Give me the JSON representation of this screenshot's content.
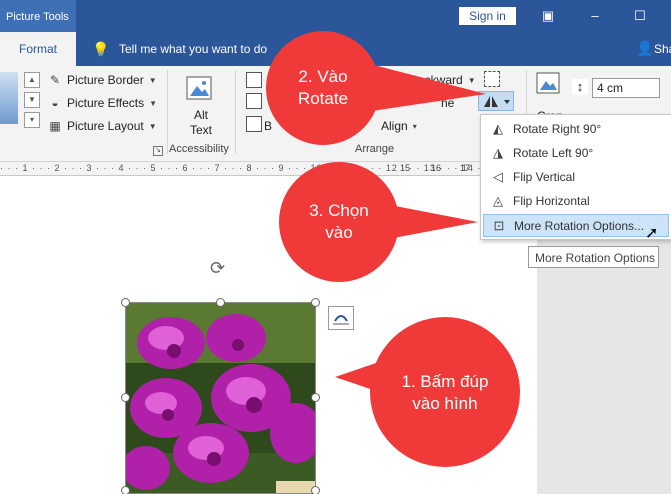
{
  "titlebar": {
    "tool_context": "Picture Tools",
    "sign_in": "Sign in"
  },
  "tabs": {
    "format": "Format",
    "tell_me": "Tell me what you want to do",
    "share": "Sha"
  },
  "ribbon": {
    "picture_border": "Picture Border",
    "picture_effects": "Picture Effects",
    "picture_layout": "Picture Layout",
    "alt_text_line1": "Alt",
    "alt_text_line2": "Text",
    "accessibility": "Accessibility",
    "send_backward": "d Backward",
    "align": "Align",
    "align_caret": "▾",
    "b_label": "B",
    "arrange": "Arrange",
    "ne_label": "ne",
    "height_value": "4 cm",
    "crop": "Crop"
  },
  "ruler": {
    "labels": [
      "15",
      "16",
      "17"
    ]
  },
  "rotate_menu": {
    "items": [
      {
        "label": "Rotate Right 90°"
      },
      {
        "label": "Rotate Left 90°"
      },
      {
        "label": "Flip Vertical"
      },
      {
        "label": "Flip Horizontal"
      },
      {
        "label": "More Rotation Options..."
      }
    ],
    "tooltip": "More Rotation Options"
  },
  "callouts": {
    "step2_line1": "2. Vào",
    "step2_line2": "Rotate",
    "step3_line1": "3. Chọn",
    "step3_line2": "vào",
    "step1_line1": "1. Bấm đúp",
    "step1_line2": "vào hình"
  },
  "colors": {
    "ribbon_blue": "#2b579a",
    "callout_red": "#f03a3a",
    "highlight": "#cde3f7"
  }
}
